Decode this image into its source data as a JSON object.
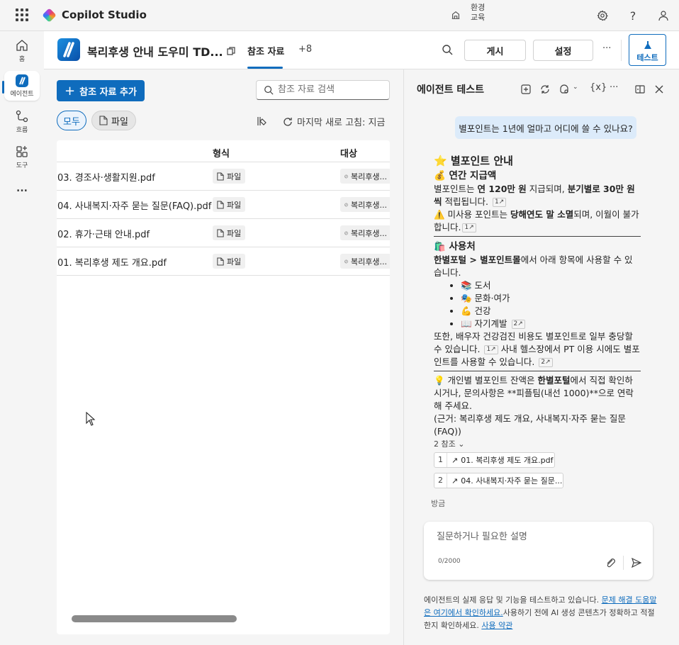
{
  "topbar": {
    "app_name": "Copilot Studio",
    "env_label": "환경",
    "env_name": "교육"
  },
  "rail": {
    "items": [
      {
        "label": "홈",
        "icon": "home-icon"
      },
      {
        "label": "에이전트",
        "icon": "agent-icon"
      },
      {
        "label": "흐름",
        "icon": "flow-icon"
      },
      {
        "label": "도구",
        "icon": "tools-icon"
      }
    ],
    "more": "..."
  },
  "header": {
    "agent_name": "복리후생 안내 도우미 TD...",
    "tab_active": "참조 자료",
    "tab_more": "+8",
    "publish": "게시",
    "settings": "설정",
    "more": "···",
    "test": "테스트"
  },
  "main": {
    "add_button": "참조 자료 추가",
    "search_placeholder": "참조 자료 검색",
    "filters": {
      "all": "모두",
      "file": "파일"
    },
    "refresh_text": "마지막 새로 고침: 지금",
    "columns": {
      "format": "형식",
      "target": "대상"
    },
    "rows": [
      {
        "name": "03. 경조사·생활지원.pdf",
        "format": "파일",
        "target": "복리후생..."
      },
      {
        "name": "04. 사내복지·자주 묻는 질문(FAQ).pdf",
        "format": "파일",
        "target": "복리후생..."
      },
      {
        "name": "02. 휴가·근태 안내.pdf",
        "format": "파일",
        "target": "복리후생..."
      },
      {
        "name": "01. 복리후생 제도 개요.pdf",
        "format": "파일",
        "target": "복리후생..."
      }
    ]
  },
  "panel": {
    "title": "에이전트 테스트",
    "var_icon": "{x}",
    "more": "···",
    "user_message": "별포인트는 1년에 얼마고 어디에 쓸 수 있나요?",
    "resp": {
      "title": "⭐ 별포인트 안내",
      "annual_heading": "💰 연간 지급액",
      "p1_a": "별포인트는 ",
      "p1_b": "연 120만 원",
      "p1_c": " 지급되며, ",
      "p1_d": "분기별로 30만 원씩",
      "p1_e": " 적립됩니다.",
      "cite1": "1",
      "p2_a": "⚠️ 미사용 포인트는 ",
      "p2_b": "당해연도 말 소멸",
      "p2_c": "되며, 이월이 불가합니다.",
      "usage_heading": "🛍️ 사용처",
      "p3_a": "한별포털 > 별포인트몰",
      "p3_b": "에서 아래 항목에 사용할 수 있습니다.",
      "items": [
        "📚 도서",
        "🎭 문화·여가",
        "💪 건강",
        "📖 자기계발"
      ],
      "cite2": "2",
      "p4": "또한, 배우자 건강검진 비용도 별포인트로 일부 충당할 수 있습니다.",
      "p4b": " 사내 헬스장에서 PT 이용 시에도 별포인트를 사용할 수 있습니다.",
      "p5_a": "💡 개인별 별포인트 잔액은 ",
      "p5_b": "한별포털",
      "p5_c": "에서 직접 확인하시거나, 문의사항은 **피플팀(내선 1000)**으로 연락해 주세요.",
      "p6": "(근거: 복리후생 제도 개요, 사내복지·자주 묻는 질문(FAQ))"
    },
    "refs_label": "2 참조",
    "refs": [
      {
        "num": "1",
        "name": "01. 복리후생 제도 개요.pdf"
      },
      {
        "num": "2",
        "name": "04. 사내복지·자주 묻는 질문..."
      }
    ],
    "timestamp": "방금",
    "input_placeholder": "질문하거나 필요한 설명",
    "char_count": "0/2000",
    "disclaimer_a": "에이전트의 실제 응답 및 기능을 테스트하고 있습니다. ",
    "disclaimer_link": "문제 해결 도움말은 여기에서 확인하세요.",
    "disclaimer_b": "사용하기 전에 AI 생성 콘텐츠가 정확하고 적절한지 확인하세요. ",
    "disclaimer_link2": "사용 약관"
  }
}
